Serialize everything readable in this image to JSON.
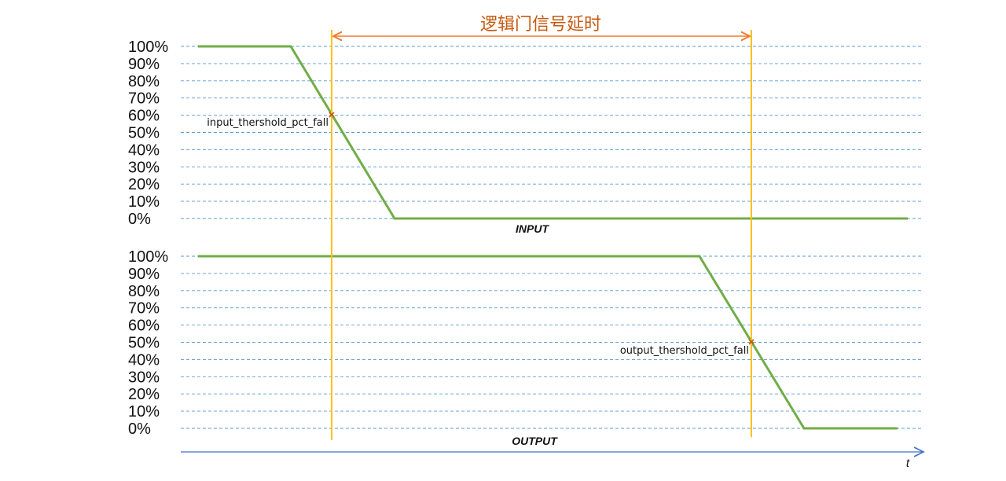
{
  "title": "逻辑门信号延时",
  "colors": {
    "signal": "#70ad47",
    "marker_line": "#ffc000",
    "grid": "#5b9bd5",
    "arrow": "#ed7d31",
    "title": "#c55a11",
    "axis": "#4472c4",
    "point": "#c55a11"
  },
  "y_ticks": [
    "100%",
    "90%",
    "80%",
    "70%",
    "60%",
    "50%",
    "40%",
    "30%",
    "20%",
    "10%",
    "0%"
  ],
  "input_panel": {
    "label": "INPUT",
    "threshold_label": "input_thershold_pct_fall",
    "threshold_pct": 60,
    "waveform_pct": [
      100,
      100,
      0,
      0
    ]
  },
  "output_panel": {
    "label": "OUTPUT",
    "threshold_label": "output_thershold_pct_fall",
    "threshold_pct": 50,
    "waveform_pct": [
      100,
      100,
      0,
      0
    ]
  },
  "time_axis_label": "t"
}
